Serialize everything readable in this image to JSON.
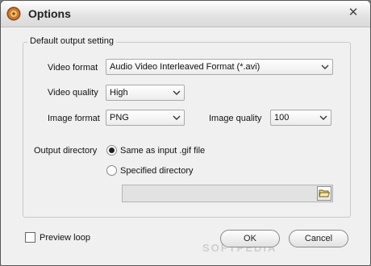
{
  "window": {
    "title": "Options",
    "close_glyph": "✕"
  },
  "group": {
    "title": "Default output setting"
  },
  "video_format": {
    "label": "Video format",
    "value": "Audio Video Interleaved Format (*.avi)"
  },
  "video_quality": {
    "label": "Video quality",
    "value": "High"
  },
  "image_format": {
    "label": "Image format",
    "value": "PNG"
  },
  "image_quality": {
    "label": "Image quality",
    "value": "100"
  },
  "output_directory": {
    "label": "Output directory",
    "options": [
      {
        "label": "Same as input .gif file",
        "selected": true
      },
      {
        "label": "Specified directory",
        "selected": false
      }
    ],
    "path_value": ""
  },
  "preview_loop": {
    "label": "Preview loop",
    "checked": false
  },
  "buttons": {
    "ok": "OK",
    "cancel": "Cancel"
  },
  "watermark": "SOFTPEDIA",
  "icons": {
    "app": "app-logo-icon",
    "close": "close-icon",
    "dropdown": "chevron-down-icon",
    "folder": "folder-open-icon"
  },
  "colors": {
    "window_bg": "#f0f0f0",
    "title_gradient_top": "#ffffff",
    "logo": "#c4661a"
  }
}
